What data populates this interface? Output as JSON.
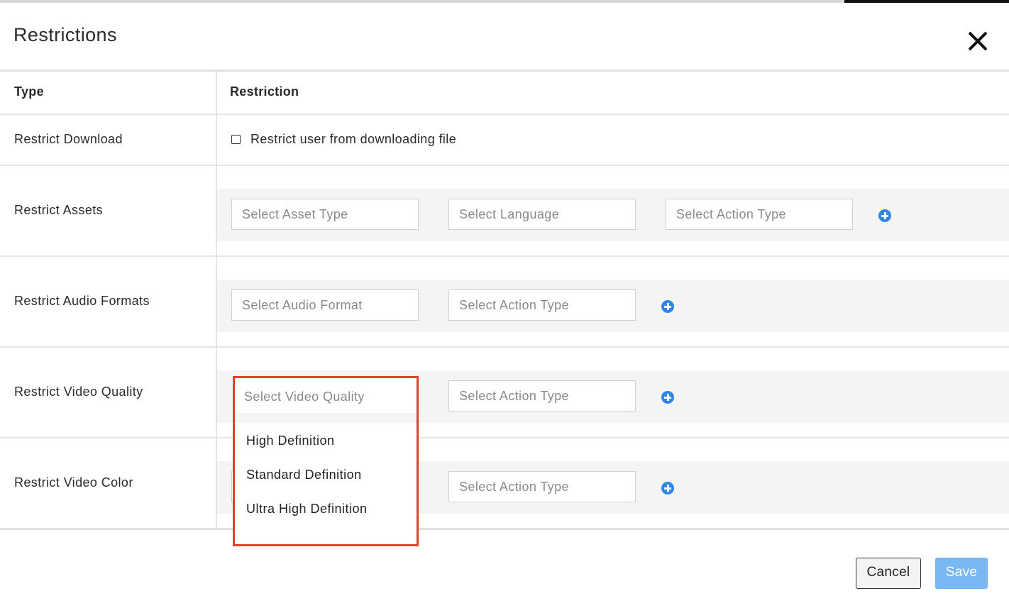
{
  "dialog": {
    "title": "Restrictions",
    "close_icon": "close-icon"
  },
  "table": {
    "headers": {
      "type": "Type",
      "restriction": "Restriction"
    },
    "rows": {
      "download": {
        "label": "Restrict Download",
        "checkbox_label": "Restrict user from downloading file",
        "checked": false
      },
      "assets": {
        "label": "Restrict Assets",
        "asset_type_placeholder": "Select Asset Type",
        "language_placeholder": "Select Language",
        "action_type_placeholder": "Select Action Type",
        "add_icon": "plus-circle-icon"
      },
      "audio": {
        "label": "Restrict Audio Formats",
        "audio_format_placeholder": "Select Audio Format",
        "action_type_placeholder": "Select Action Type",
        "add_icon": "plus-circle-icon"
      },
      "video_quality": {
        "label": "Restrict Video Quality",
        "video_quality_placeholder": "Select Video Quality",
        "action_type_placeholder": "Select Action Type",
        "add_icon": "plus-circle-icon",
        "dropdown_options": [
          "High Definition",
          "Standard Definition",
          "Ultra High Definition"
        ]
      },
      "video_color": {
        "label": "Restrict Video Color",
        "action_type_placeholder": "Select Action Type",
        "add_icon": "plus-circle-icon"
      }
    }
  },
  "footer": {
    "cancel_label": "Cancel",
    "save_label": "Save"
  },
  "colors": {
    "accent": "#2f88e8",
    "highlight_border": "#e5402e",
    "save_button": "#7ab8f4"
  }
}
